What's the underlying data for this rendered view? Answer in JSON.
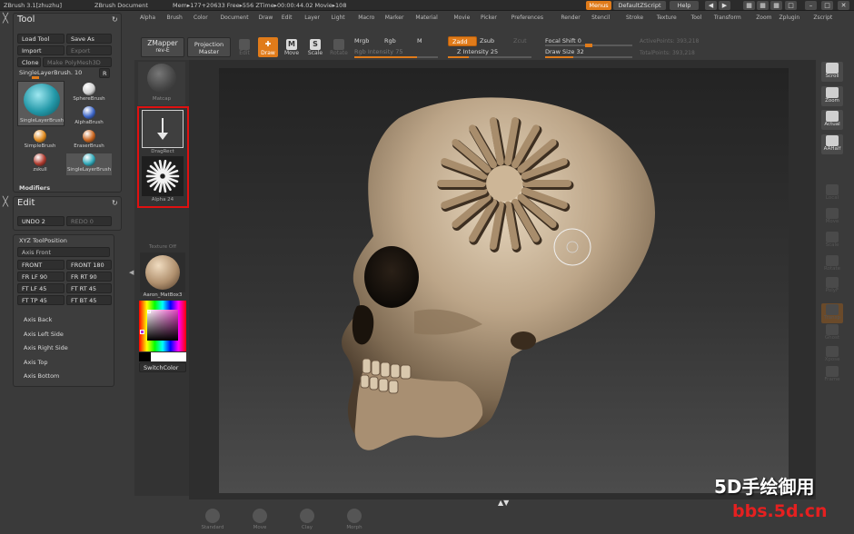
{
  "titlebar": {
    "app": "ZBrush  3.1[zhuzhu]",
    "document": "ZBrush Document",
    "stats": "Mem▸177+20633  Free▸556  ZTime▸00:00:44.02  Movie▸108",
    "menus_button": "Menus",
    "script_button": "DefaultZScript",
    "help_button": "Help"
  },
  "menubar": {
    "items": [
      "Alpha",
      "Brush",
      "Color",
      "Document",
      "Draw",
      "Edit",
      "Layer",
      "Light",
      "Macro",
      "Marker",
      "Material",
      "Movie",
      "Picker",
      "Preferences",
      "Render",
      "Stencil",
      "Stroke",
      "Texture",
      "Tool",
      "Transform",
      "Zoom",
      "Zplugin",
      "Zscript"
    ]
  },
  "tool_panel": {
    "title": "Tool",
    "load_tool": "Load Tool",
    "save_as": "Save As",
    "import": "Import",
    "export": "Export",
    "clone": "Clone",
    "make_polymesh": "Make PolyMesh3D",
    "current_tool": "SingleLayerBrush. 10",
    "r_button": "R",
    "current_tool_thumb_label": "SingleLayerBrush",
    "brushes": [
      {
        "name": "SphereBrush",
        "color": "#cfcfcf"
      },
      {
        "name": "AlphaBrush",
        "color": "#3c66c8"
      },
      {
        "name": "SimpleBrush",
        "color": "#e08a1e"
      },
      {
        "name": "EraserBrush",
        "color": "#c8641e"
      },
      {
        "name": "zskull",
        "color": "#b03a2e"
      },
      {
        "name": "SingleLayerBrush",
        "color": "#2fa8b8"
      }
    ],
    "modifiers": "Modifiers"
  },
  "edit_panel": {
    "title": "Edit",
    "undo": "UNDO 2",
    "redo": "REDO 0"
  },
  "xyz_panel": {
    "title": "XYZ ToolPosition",
    "axis_front_header": "Axis Front",
    "buttons": [
      "FRONT",
      "FRONT 180",
      "FR LF 90",
      "FR RT 90",
      "FT LF 45",
      "FT RT 45",
      "FT TP 45",
      "FT BT 45"
    ],
    "axis_items": [
      "Axis Back",
      "Axis Left Side",
      "Axis Right Side",
      "Axis Top",
      "Axis Bottom"
    ]
  },
  "left_shelf": {
    "material_label": "Matcap",
    "stroke_label": "DragRect",
    "alpha_label": "Alpha 24",
    "texture_label": "Texture Off",
    "material2_label": "Aaron_MatBox3",
    "switch_color": "SwitchColor",
    "main_color": "#000000",
    "secondary_color": "#ffffff"
  },
  "top_shelf": {
    "zmapper": "ZMapper",
    "zmapper_sub": "rev-E",
    "projection": "Projection",
    "projection_sub": "Master",
    "edit_label": "Edit",
    "draw_label": "Draw",
    "move_label": "Move",
    "scale_label": "Scale",
    "rotate_label": "Rotate",
    "mrgb": "Mrgb",
    "rgb": "Rgb",
    "m": "M",
    "rgb_intensity": "Rgb Intensity 75",
    "rgb_intensity_value": 75,
    "zadd": "Zadd",
    "zsub": "Zsub",
    "zcut": "Zcut",
    "z_intensity": "Z Intensity 25",
    "z_intensity_value": 25,
    "focal_shift": "Focal Shift 0",
    "focal_shift_value": 0,
    "draw_size": "Draw Size 32",
    "draw_size_value": 32,
    "active_points": "ActivePoints: 393,218",
    "total_points": "TotalPoints: 393,218"
  },
  "right_tray": {
    "items": [
      "Scroll",
      "Zoom",
      "Actual",
      "AAHalf",
      "Local",
      "Move",
      "Scale",
      "Rotate",
      "PolyF",
      "Transp",
      "Ghost",
      "Xpose",
      "Frame"
    ]
  },
  "bottom_tray": {
    "items": [
      "Standard",
      "Move",
      "Clay",
      "Morph"
    ]
  },
  "watermark": {
    "line1": "5D手绘御用",
    "line2": "bbs.5d.cn"
  }
}
